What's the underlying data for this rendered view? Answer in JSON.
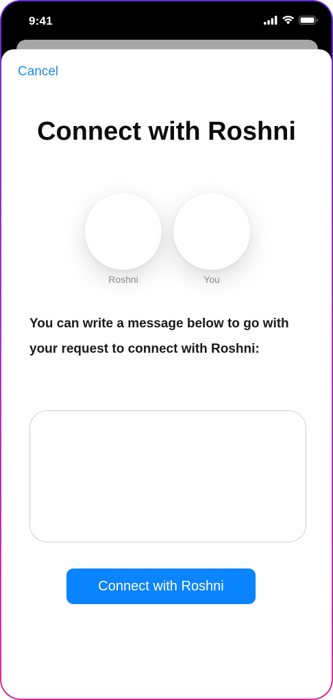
{
  "status_bar": {
    "time": "9:41",
    "icons": [
      "cellular-signal-icon",
      "wifi-icon",
      "battery-icon"
    ]
  },
  "sheet": {
    "cancel_label": "Cancel",
    "title": "Connect with Roshni",
    "avatars": [
      {
        "label": "Roshni"
      },
      {
        "label": "You"
      }
    ],
    "message_prompt": "You can write a message below to go with your request to connect  with Roshni:",
    "message_input": {
      "value": "",
      "placeholder": ""
    },
    "connect_button_label": "Connect with Roshni"
  },
  "colors": {
    "accent": "#0a84ff",
    "link": "#1a8cf0",
    "frame_gradient_top": "#6a2bd9",
    "frame_gradient_bottom": "#e8259a"
  }
}
